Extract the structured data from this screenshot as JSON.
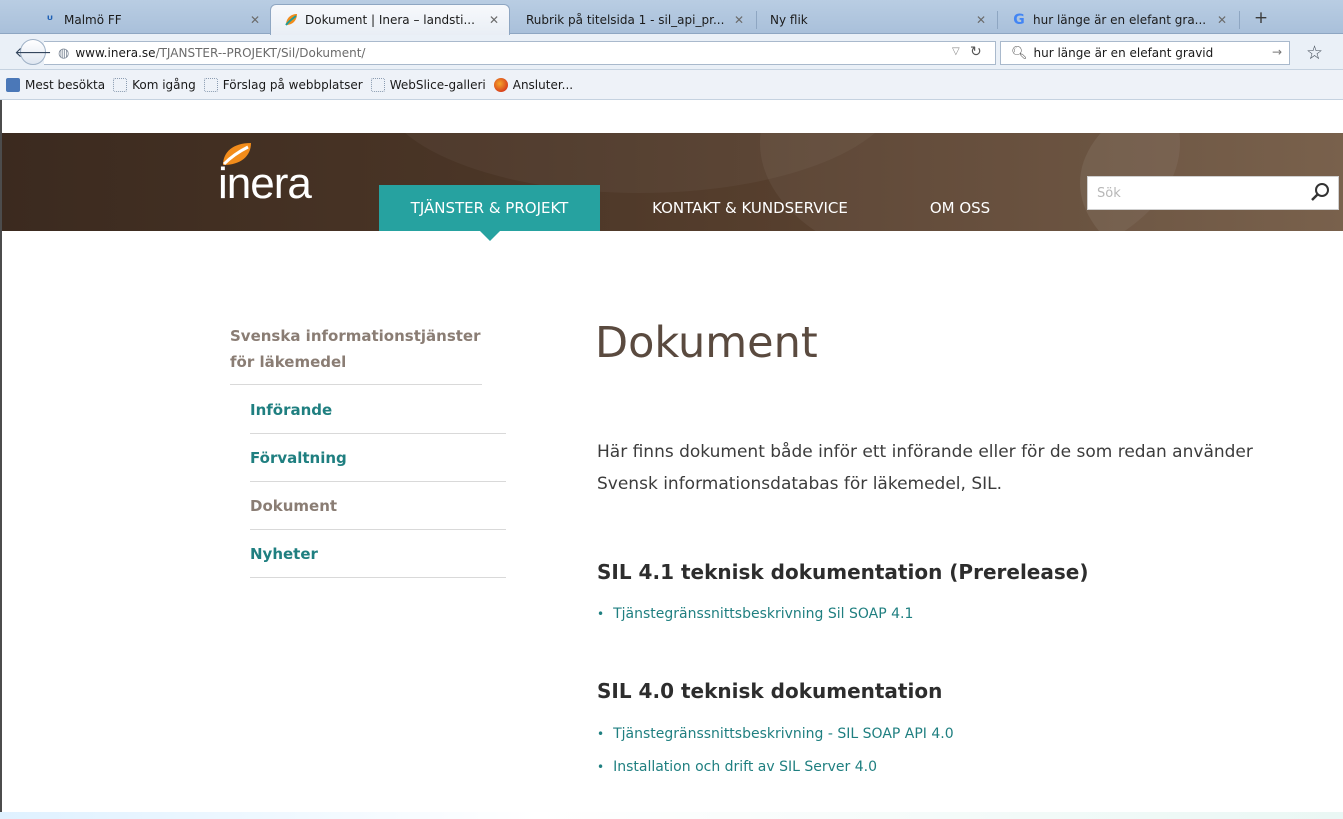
{
  "browser": {
    "tabs": [
      {
        "title": "Malmö FF",
        "icon": "malmo-ff-icon"
      },
      {
        "title": "Dokument | Inera – landsti...",
        "icon": "inera-icon",
        "active": true
      },
      {
        "title": "Rubrik på titelsida 1 - sil_api_pr...",
        "icon": ""
      },
      {
        "title": "Ny flik",
        "icon": ""
      },
      {
        "title": "hur länge är en elefant gra...",
        "icon": "google-icon"
      }
    ],
    "new_tab_label": "+",
    "url_host": "www.inera.se",
    "url_path": "/TJANSTER--PROJEKT/Sil/Dokument/",
    "search_value": "hur länge är en elefant gravid",
    "bookmarks": [
      "Mest besökta",
      "Kom igång",
      "Förslag på webbplatser",
      "WebSlice-galleri",
      "Ansluter..."
    ]
  },
  "site": {
    "logo_text": "inera",
    "nav": {
      "tjanster": "TJÄNSTER & PROJEKT",
      "kontakt": "KONTAKT & KUNDSERVICE",
      "om": "OM OSS"
    },
    "search_placeholder": "Sök",
    "colors": {
      "accent": "#26a2a0",
      "link": "#1f7f80",
      "header_bg": "#4a3526"
    }
  },
  "sidebar": {
    "section_title": "Svenska informationstjänster för läkemedel",
    "items": [
      {
        "label": "Införande"
      },
      {
        "label": "Förvaltning"
      },
      {
        "label": "Dokument",
        "current": true
      },
      {
        "label": "Nyheter"
      }
    ]
  },
  "main": {
    "title": "Dokument",
    "intro": "Här finns dokument både inför ett införande eller för de som redan använder Svensk informationsdatabas för läkemedel, SIL.",
    "sections": [
      {
        "heading": "SIL 4.1 teknisk dokumentation (Prerelease)",
        "links": [
          "Tjänstegränssnittsbeskrivning Sil SOAP 4.1"
        ]
      },
      {
        "heading": "SIL 4.0 teknisk dokumentation",
        "links": [
          "Tjänstegränssnittsbeskrivning - SIL SOAP API 4.0",
          "Installation och drift av SIL Server 4.0"
        ]
      }
    ]
  }
}
